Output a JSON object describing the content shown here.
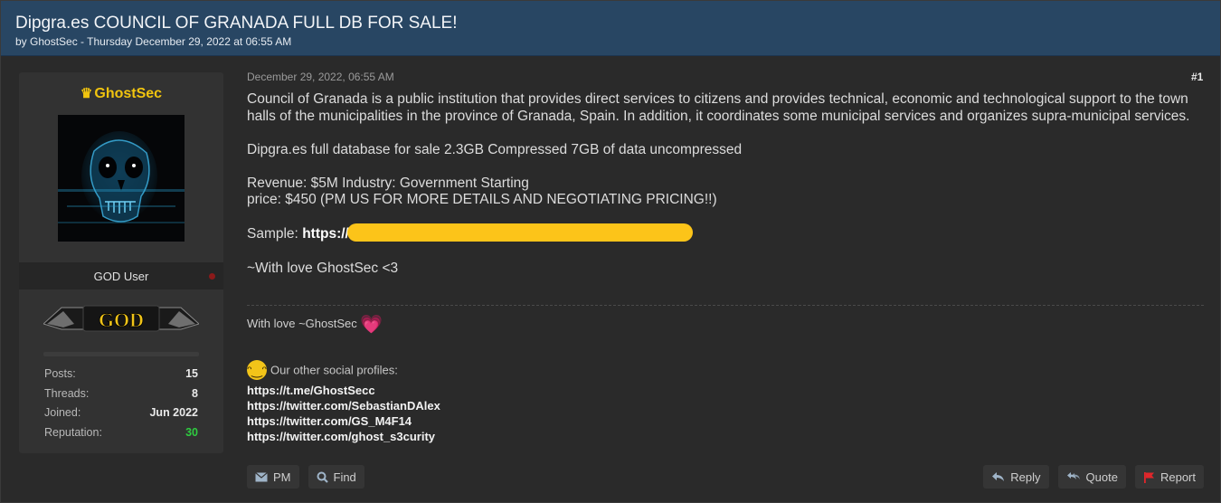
{
  "thread": {
    "title": "Dipgra.es COUNCIL OF GRANADA FULL DB FOR SALE!",
    "meta": "by GhostSec - Thursday December 29, 2022 at 06:55 AM"
  },
  "user": {
    "name": "GhostSec",
    "crown_icon": "crown-icon",
    "role": "GOD User",
    "badge_text": "GOD",
    "stats": [
      {
        "label": "Posts:",
        "value": "15"
      },
      {
        "label": "Threads:",
        "value": "8"
      },
      {
        "label": "Joined:",
        "value": "Jun 2022"
      },
      {
        "label": "Reputation:",
        "value": "30"
      }
    ],
    "reputation_color": "#2ecc40"
  },
  "post": {
    "date": "December 29, 2022, 06:55 AM",
    "number": "#1",
    "paragraph1": "Council of Granada is a public institution that provides direct services to citizens and provides technical, economic and technological support to the town halls of the municipalities in the province of Granada, Spain. In addition, it coordinates some municipal services and organizes supra-municipal services.",
    "paragraph2": "Dipgra.es full database for sale  2.3GB Compressed 7GB of data uncompressed",
    "revenue_line": "Revenue: $5M Industry: Government Starting",
    "price_line": "price: $450 (PM US FOR MORE DETAILS AND NEGOTIATING PRICING!!)",
    "sample_label": "Sample:",
    "sample_link": "https://",
    "closing": "~With love GhostSec <3"
  },
  "signature": {
    "text": "With love ~GhostSec",
    "heart": "💗",
    "social_heading": "Our other social profiles:",
    "grin_emoji": "😁",
    "links": [
      "https://t.me/GhostSecc",
      "https://twitter.com/SebastianDAlex",
      "https://twitter.com/GS_M4F14",
      "https://twitter.com/ghost_s3curity"
    ]
  },
  "actions": {
    "pm": "PM",
    "find": "Find",
    "reply": "Reply",
    "quote": "Quote",
    "report": "Report"
  },
  "colors": {
    "header_bg": "#284663",
    "username": "#f1c40f",
    "redaction": "#fcc419",
    "report_flag": "#e0262b"
  }
}
